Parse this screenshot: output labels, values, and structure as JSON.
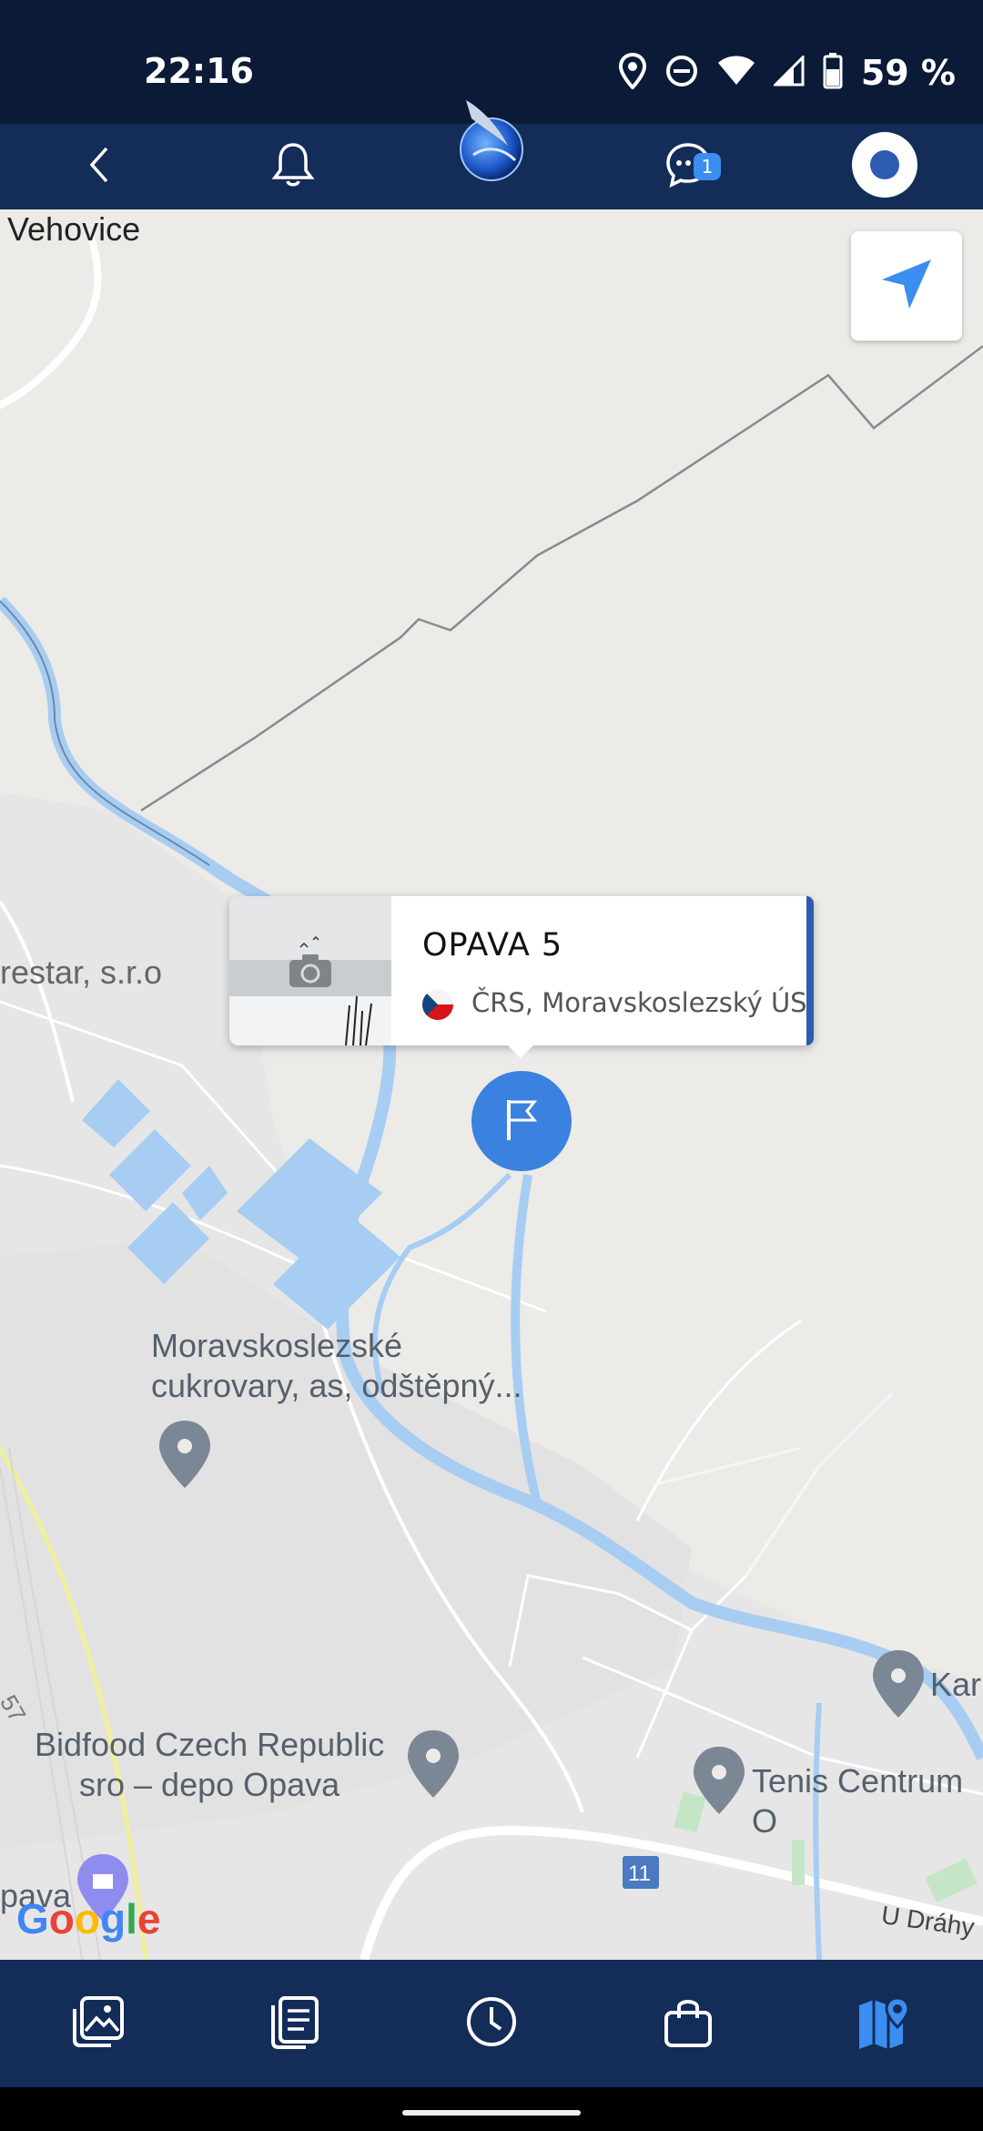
{
  "status_bar": {
    "time": "22:16",
    "battery": "59 %",
    "icons": [
      "location-icon",
      "do-not-disturb-icon",
      "wifi-icon",
      "signal-icon",
      "battery-icon"
    ]
  },
  "app_bar": {
    "items": [
      "back-icon",
      "bell-icon",
      "app-logo",
      "chat-icon",
      "profile-icon"
    ],
    "chat_badge": "1"
  },
  "map": {
    "labels": {
      "vehovice": "Vehovice",
      "restar": "restar, s.r.o",
      "cukrovary": "Moravskoslezské\ncukrovary, as, odštěpný...",
      "bidfood": "Bidfood Czech Republic\nsro – depo Opava",
      "tenis": "Tenis Centrum O",
      "kan": "Kar",
      "opava": "pava",
      "road_number": "11",
      "u_drahy": "U Dráhy",
      "road_57": "57"
    },
    "google_logo": [
      "G",
      "o",
      "o",
      "g",
      "l",
      "e"
    ],
    "google_colors": [
      "#4285F4",
      "#EA4335",
      "#FBBC05",
      "#4285F4",
      "#34A853",
      "#EA4335"
    ],
    "colors": {
      "land": "#ecebe8",
      "water": "#a7cdf2",
      "road": "#ffffff",
      "marker": "#3b82e0"
    }
  },
  "popup": {
    "title": "OPAVA 5",
    "subtitle": "ČRS, Moravskoslezský ÚS",
    "flag": "czech-flag-icon"
  },
  "bottom_nav": {
    "items": [
      "gallery-icon",
      "notes-icon",
      "history-icon",
      "shop-icon",
      "map-icon"
    ],
    "active": "map-icon",
    "active_color": "#3b8ef0"
  }
}
